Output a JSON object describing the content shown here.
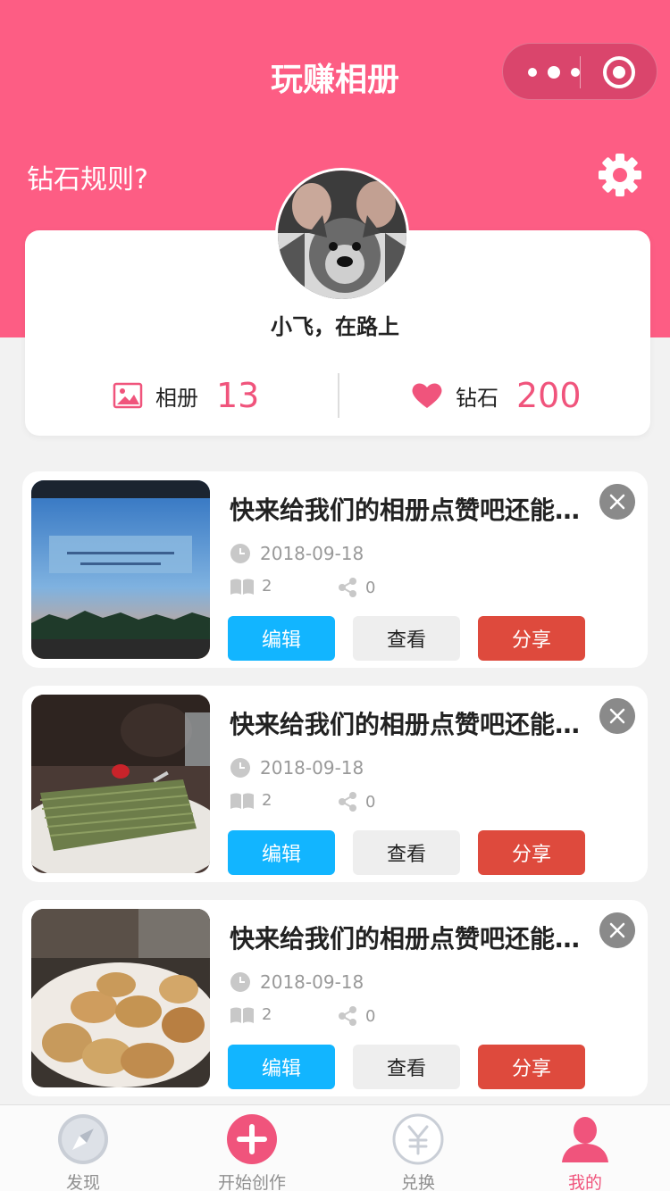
{
  "header": {
    "title": "玩赚相册",
    "rules_link": "钻石规则?"
  },
  "profile": {
    "nickname": "小飞，在路上",
    "album_label": "相册",
    "album_count": "13",
    "diamond_label": "钻石",
    "diamond_count": "200"
  },
  "albums": [
    {
      "title": "快来给我们的相册点赞吧还能兑换话费哟",
      "date": "2018-09-18",
      "pages": "2",
      "shares": "0"
    },
    {
      "title": "快来给我们的相册点赞吧还能兑换话费哟",
      "date": "2018-09-18",
      "pages": "2",
      "shares": "0"
    },
    {
      "title": "快来给我们的相册点赞吧还能兑换话费哟",
      "date": "2018-09-18",
      "pages": "2",
      "shares": "0"
    }
  ],
  "album_actions": {
    "edit": "编辑",
    "view": "查看",
    "share": "分享"
  },
  "tabbar": {
    "items": [
      {
        "label": "发现",
        "icon": "compass-icon"
      },
      {
        "label": "开始创作",
        "icon": "plus-circle-icon"
      },
      {
        "label": "兑换",
        "icon": "yuan-icon"
      },
      {
        "label": "我的",
        "icon": "person-icon",
        "active": true
      }
    ]
  },
  "colors": {
    "brand_pink": "#fd5d84",
    "accent_pink": "#f0547c",
    "edit_blue": "#12b5ff",
    "share_red": "#de4a3d"
  }
}
